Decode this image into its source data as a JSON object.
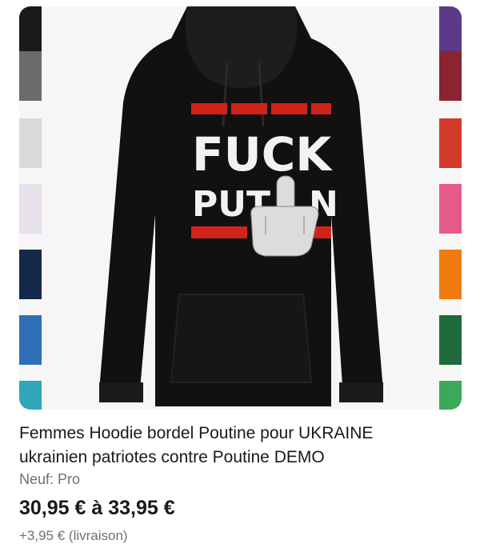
{
  "listing": {
    "image": {
      "shirt_text_line1": "FUCK",
      "shirt_text_line2": "PUT",
      "shirt_text_line2_end": "N",
      "hand_gesture": "middle-finger-hand",
      "garment_color": "#111111",
      "stripe_color": "#d2231b"
    },
    "swatches_left": [
      "#1a1a1a",
      "#6b6b6b",
      "#d9d9d9",
      "#e8e0ea",
      "#14284a",
      "#2f6fb5",
      "#2fa7b8"
    ],
    "swatches_right": [
      "#5b3a8a",
      "#8c2330",
      "#d23a2a",
      "#e65a8a",
      "#ee7a10",
      "#1f6a3a",
      "#3ca85a"
    ],
    "title_line1": "Femmes Hoodie bordel Poutine pour UKRAINE",
    "title_line2": "ukrainien patriotes contre Poutine DEMO",
    "condition": "Neuf: Pro",
    "price": "30,95 € à 33,95 €",
    "shipping": "+3,95 € (livraison)"
  }
}
